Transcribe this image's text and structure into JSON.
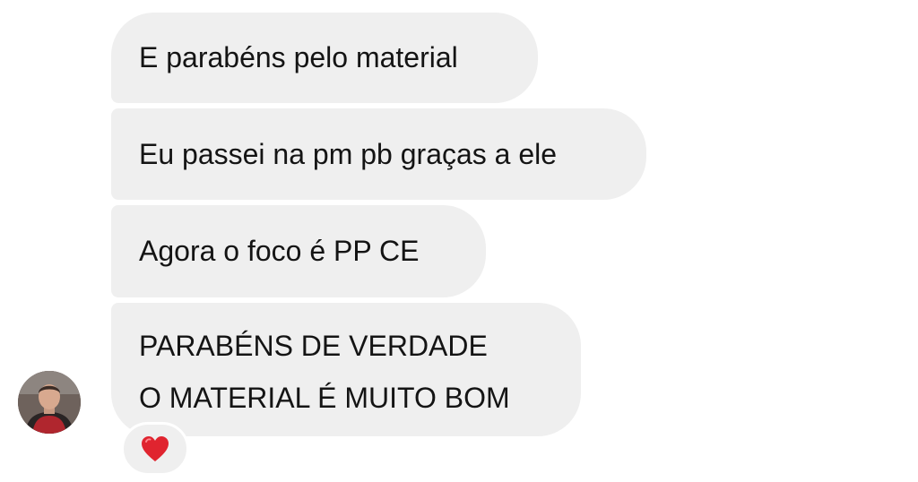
{
  "chat": {
    "messages": [
      {
        "text": "E parabéns pelo material"
      },
      {
        "text": "Eu passei na pm pb graças a ele"
      },
      {
        "text": "Agora o foco é PP CE"
      },
      {
        "lines": [
          "PARABÉNS DE VERDADE",
          "O MATERIAL É MUITO BOM"
        ]
      }
    ],
    "reaction": {
      "icon": "heart-icon",
      "color": "#e0242f"
    },
    "avatar": {
      "icon": "user-avatar"
    }
  },
  "colors": {
    "bubble_background": "#efefef",
    "text": "#141414",
    "page_background": "#ffffff"
  }
}
